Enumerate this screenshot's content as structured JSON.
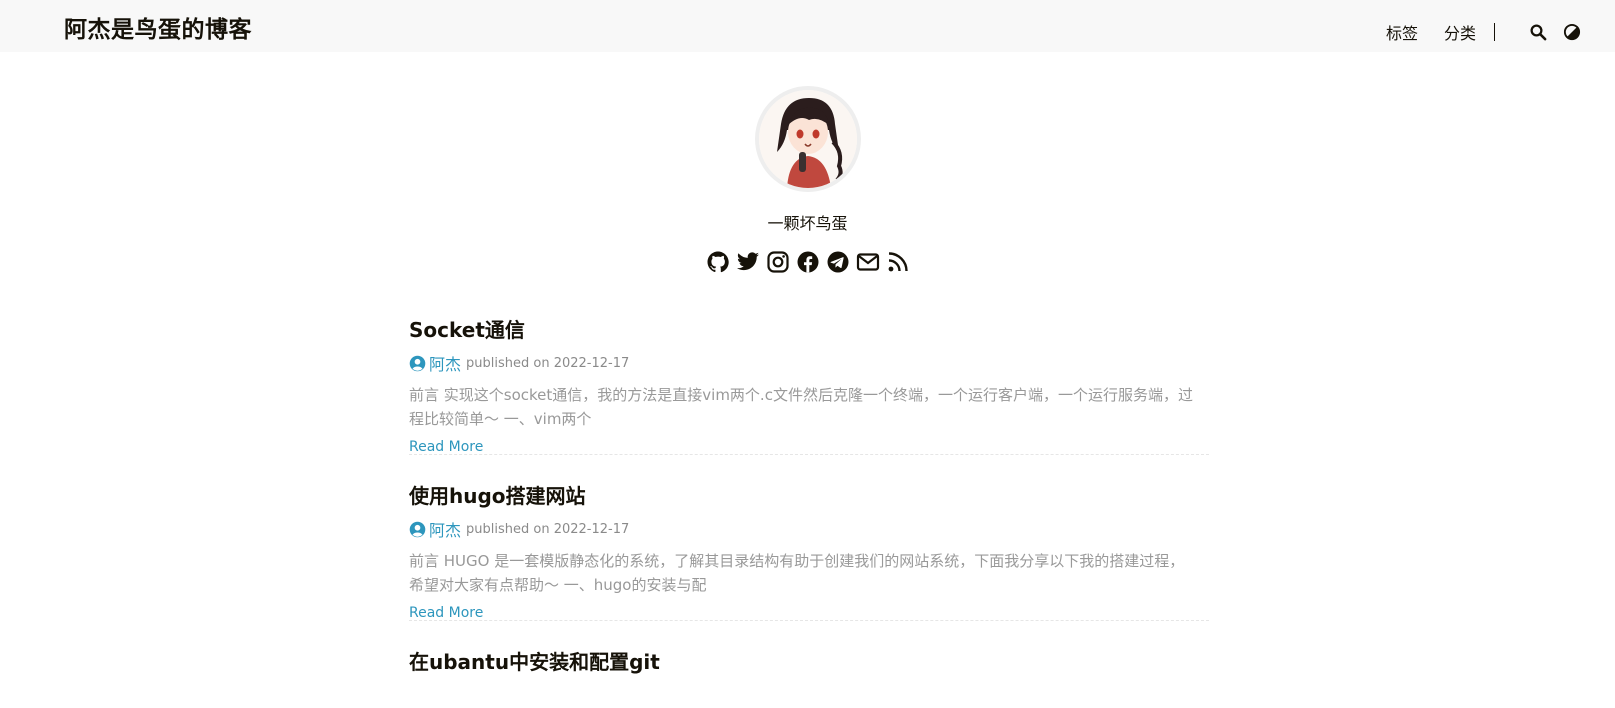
{
  "site": {
    "title": "阿杰是鸟蛋的博客"
  },
  "nav": {
    "items": [
      {
        "label": "标签"
      },
      {
        "label": "分类"
      }
    ]
  },
  "profile": {
    "subtitle": "一颗坏鸟蛋"
  },
  "socials": [
    "github-icon",
    "twitter-icon",
    "instagram-icon",
    "facebook-icon",
    "telegram-icon",
    "email-icon",
    "rss-icon"
  ],
  "colors": {
    "accent": "#2d96bd",
    "text": "#161209",
    "muted": "#999999",
    "header_bg": "#f8f8f8"
  },
  "posts": [
    {
      "title": "Socket通信",
      "author": "阿杰",
      "meta": "published on 2022-12-17",
      "summary": "前言 实现这个socket通信，我的方法是直接vim两个.c文件然后克隆一个终端，一个运行客户端，一个运行服务端，过程比较简单～ 一、vim两个",
      "read_more": "Read More"
    },
    {
      "title": "使用hugo搭建网站",
      "author": "阿杰",
      "meta": "published on 2022-12-17",
      "summary": "前言 HUGO 是一套模版静态化的系统，了解其目录结构有助于创建我们的网站系统，下面我分享以下我的搭建过程，希望对大家有点帮助～ 一、hugo的安装与配",
      "read_more": "Read More"
    },
    {
      "title": "在ubantu中安装和配置git"
    }
  ]
}
